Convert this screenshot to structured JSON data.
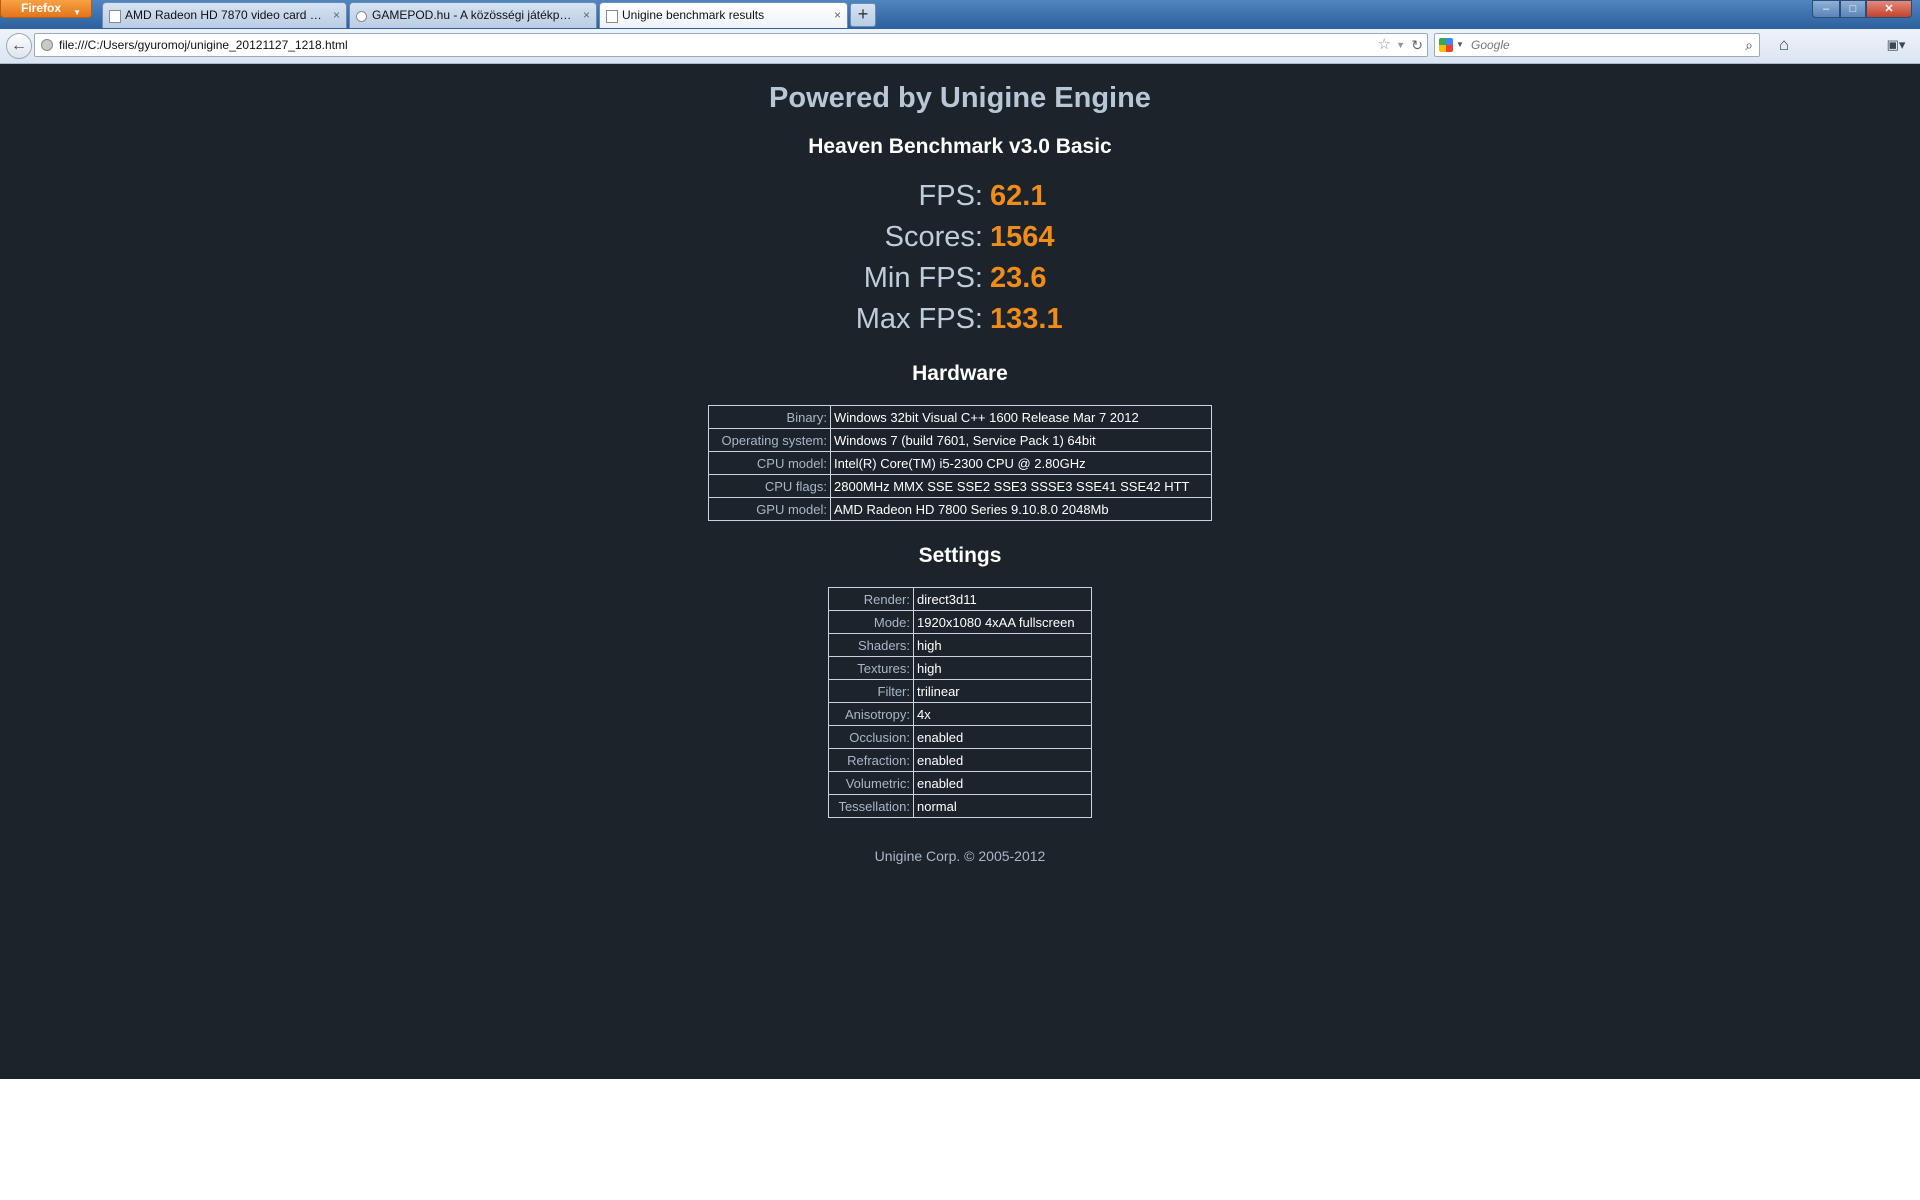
{
  "browser": {
    "menu_button": "Firefox",
    "tabs": [
      {
        "title": "AMD Radeon HD 7870 video card ben...",
        "active": false
      },
      {
        "title": "GAMEPOD.hu - A közösségi játékportál",
        "active": false
      },
      {
        "title": "Unigine benchmark results",
        "active": true
      }
    ],
    "new_tab": "+",
    "url": "file:///C:/Users/gyuromoj/unigine_20121127_1218.html",
    "search_placeholder": "Google"
  },
  "page": {
    "powered_by": "Powered by Unigine Engine",
    "benchmark_title": "Heaven Benchmark v3.0 Basic",
    "metrics": {
      "fps_label": "FPS:",
      "fps_value": "62.1",
      "scores_label": "Scores:",
      "scores_value": "1564",
      "min_fps_label": "Min FPS:",
      "min_fps_value": "23.6",
      "max_fps_label": "Max FPS:",
      "max_fps_value": "133.1"
    },
    "hardware_title": "Hardware",
    "hardware": [
      {
        "key": "Binary:",
        "value": "Windows 32bit Visual C++ 1600 Release Mar 7 2012"
      },
      {
        "key": "Operating system:",
        "value": "Windows 7 (build 7601, Service Pack 1) 64bit"
      },
      {
        "key": "CPU model:",
        "value": "Intel(R) Core(TM) i5-2300 CPU @ 2.80GHz"
      },
      {
        "key": "CPU flags:",
        "value": "2800MHz MMX SSE SSE2 SSE3 SSSE3 SSE41 SSE42 HTT"
      },
      {
        "key": "GPU model:",
        "value": "AMD Radeon HD 7800 Series 9.10.8.0 2048Mb"
      }
    ],
    "settings_title": "Settings",
    "settings": [
      {
        "key": "Render:",
        "value": "direct3d11"
      },
      {
        "key": "Mode:",
        "value": "1920x1080 4xAA fullscreen"
      },
      {
        "key": "Shaders:",
        "value": "high"
      },
      {
        "key": "Textures:",
        "value": "high"
      },
      {
        "key": "Filter:",
        "value": "trilinear"
      },
      {
        "key": "Anisotropy:",
        "value": "4x"
      },
      {
        "key": "Occlusion:",
        "value": "enabled"
      },
      {
        "key": "Refraction:",
        "value": "enabled"
      },
      {
        "key": "Volumetric:",
        "value": "enabled"
      },
      {
        "key": "Tessellation:",
        "value": "normal"
      }
    ],
    "copyright": "Unigine Corp. © 2005-2012"
  },
  "colors": {
    "page_background": "#1c232b",
    "metric_value": "#f08c18",
    "label_text": "#bfcddb"
  }
}
